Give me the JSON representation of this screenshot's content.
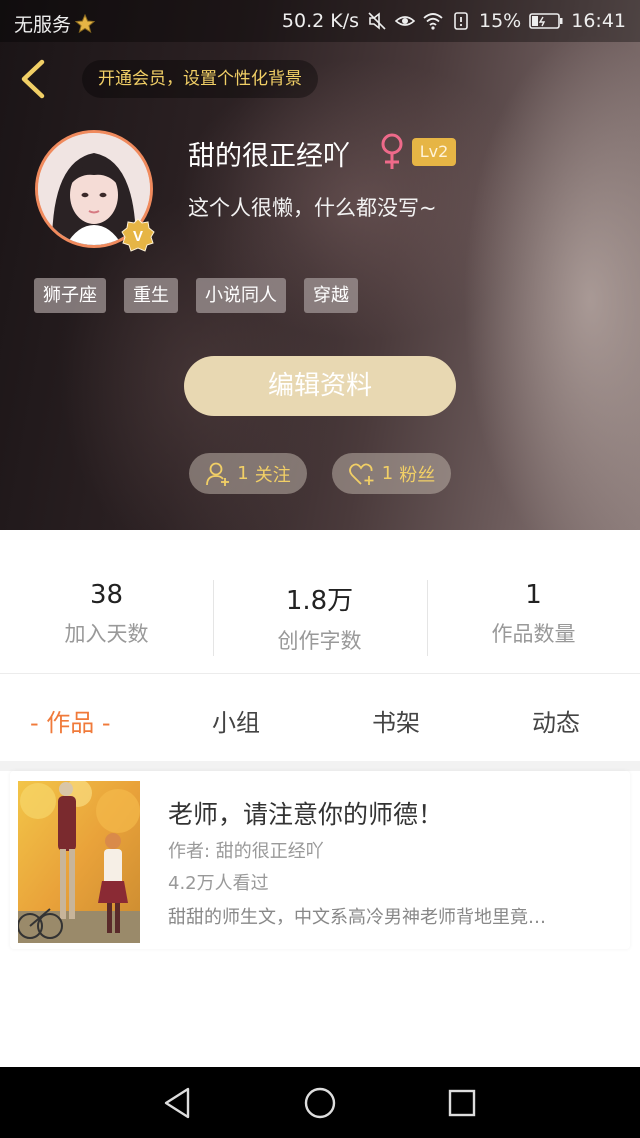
{
  "status_bar": {
    "carrier": "无服务",
    "speed": "50.2 K/s",
    "battery": "15%",
    "time": "16:41"
  },
  "header": {
    "vip_banner": "开通会员，设置个性化背景",
    "username": "甜的很正经吖",
    "level": "Lv2",
    "bio": "这个人很懒，什么都没写~",
    "tags": [
      "狮子座",
      "重生",
      "小说同人",
      "穿越"
    ],
    "edit_button": "编辑资料",
    "follow_count": "1",
    "follow_label": "关注",
    "fans_count": "1",
    "fans_label": "粉丝"
  },
  "stats": [
    {
      "value": "38",
      "label": "加入天数"
    },
    {
      "value": "1.8万",
      "label": "创作字数"
    },
    {
      "value": "1",
      "label": "作品数量"
    }
  ],
  "tabs": [
    {
      "label": "- 作品 -",
      "active": true
    },
    {
      "label": "小组",
      "active": false
    },
    {
      "label": "书架",
      "active": false
    },
    {
      "label": "动态",
      "active": false
    }
  ],
  "work": {
    "title": "老师，请注意你的师德！",
    "author": "作者: 甜的很正经吖",
    "views": "4.2万人看过",
    "description": "甜甜的师生文，中文系高冷男神老师背地里竟…"
  },
  "colors": {
    "accent": "#f07a3a",
    "gold": "#f1cf66",
    "edit_button": "#e8d8b2",
    "level_badge": "#e6b545",
    "avatar_border": "#f08a5d"
  }
}
